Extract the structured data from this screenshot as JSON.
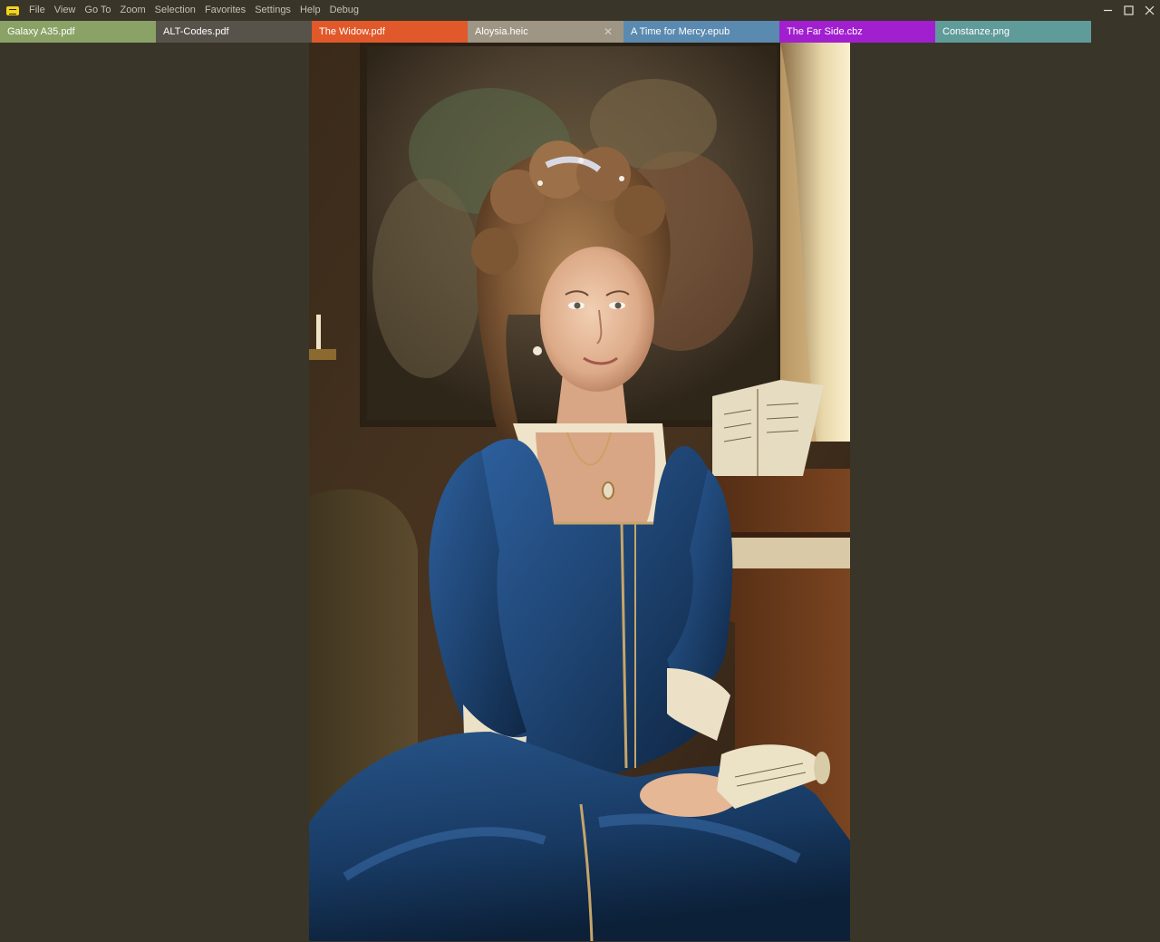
{
  "menu": {
    "items": [
      "File",
      "View",
      "Go To",
      "Zoom",
      "Selection",
      "Favorites",
      "Settings",
      "Help",
      "Debug"
    ]
  },
  "window_controls": {
    "minimize": "minimize-icon",
    "maximize": "maximize-icon",
    "close": "close-icon"
  },
  "tabs": [
    {
      "label": "Galaxy A35.pdf",
      "color": "#8aa266"
    },
    {
      "label": "ALT-Codes.pdf",
      "color": "#57534a"
    },
    {
      "label": "The Widow.pdf",
      "color": "#e1582a"
    },
    {
      "label": "Aloysia.heic",
      "color": "#9e9584",
      "active": true,
      "close_icon": "close-icon"
    },
    {
      "label": "A Time for Mercy.epub",
      "color": "#5a8ab0"
    },
    {
      "label": "The Far Side.cbz",
      "color": "#a11fcf"
    },
    {
      "label": "Constanze.png",
      "color": "#5f9b99"
    }
  ],
  "viewer": {
    "image_description_icon": "portrait-image",
    "background_color": "#393529"
  }
}
